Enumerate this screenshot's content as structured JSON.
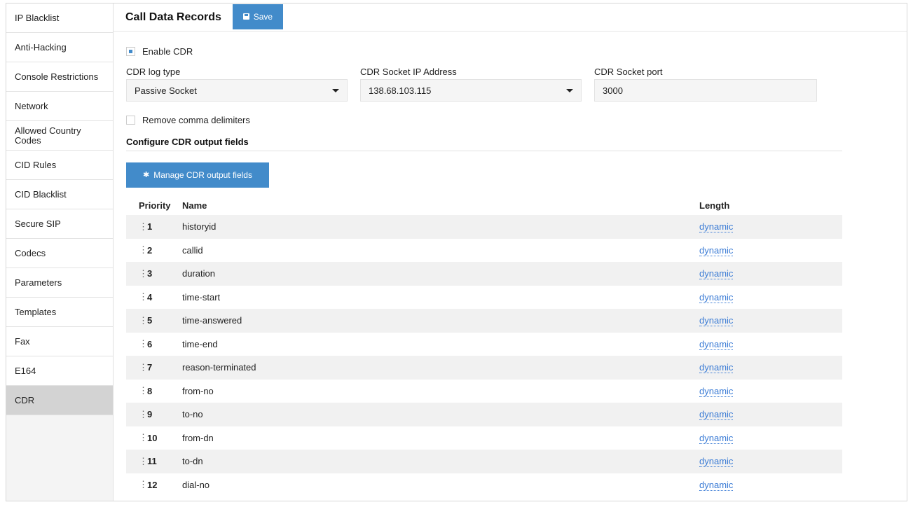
{
  "sidebar": {
    "items": [
      {
        "label": "IP Blacklist"
      },
      {
        "label": "Anti-Hacking"
      },
      {
        "label": "Console Restrictions"
      },
      {
        "label": "Network"
      },
      {
        "label": "Allowed Country Codes"
      },
      {
        "label": "CID Rules"
      },
      {
        "label": "CID Blacklist"
      },
      {
        "label": "Secure SIP"
      },
      {
        "label": "Codecs"
      },
      {
        "label": "Parameters"
      },
      {
        "label": "Templates"
      },
      {
        "label": "Fax"
      },
      {
        "label": "E164"
      },
      {
        "label": "CDR"
      }
    ],
    "active": "CDR"
  },
  "header": {
    "title": "Call Data Records",
    "save_label": "Save"
  },
  "form": {
    "enable_cdr": {
      "label": "Enable CDR",
      "checked": true
    },
    "log_type": {
      "label": "CDR log type",
      "value": "Passive Socket"
    },
    "socket_ip": {
      "label": "CDR Socket IP Address",
      "value": "138.68.103.115"
    },
    "socket_port": {
      "label": "CDR Socket port",
      "value": "3000"
    },
    "remove_comma": {
      "label": "Remove comma delimiters",
      "checked": false
    }
  },
  "output": {
    "section_title": "Configure CDR output fields",
    "manage_label": "Manage CDR output fields",
    "columns": {
      "priority": "Priority",
      "name": "Name",
      "length": "Length"
    },
    "rows": [
      {
        "priority": "1",
        "name": "historyid",
        "length": "dynamic"
      },
      {
        "priority": "2",
        "name": "callid",
        "length": "dynamic"
      },
      {
        "priority": "3",
        "name": "duration",
        "length": "dynamic"
      },
      {
        "priority": "4",
        "name": "time-start",
        "length": "dynamic"
      },
      {
        "priority": "5",
        "name": "time-answered",
        "length": "dynamic"
      },
      {
        "priority": "6",
        "name": "time-end",
        "length": "dynamic"
      },
      {
        "priority": "7",
        "name": "reason-terminated",
        "length": "dynamic"
      },
      {
        "priority": "8",
        "name": "from-no",
        "length": "dynamic"
      },
      {
        "priority": "9",
        "name": "to-no",
        "length": "dynamic"
      },
      {
        "priority": "10",
        "name": "from-dn",
        "length": "dynamic"
      },
      {
        "priority": "11",
        "name": "to-dn",
        "length": "dynamic"
      },
      {
        "priority": "12",
        "name": "dial-no",
        "length": "dynamic"
      }
    ]
  },
  "colors": {
    "accent": "#428bca",
    "link": "#3a7bd5",
    "active_item": "#d3d3d3"
  }
}
